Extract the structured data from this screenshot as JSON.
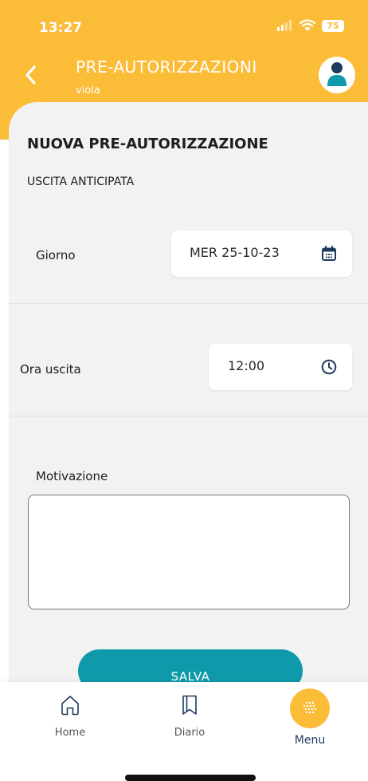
{
  "status_bar": {
    "time": "13:27",
    "battery": "75"
  },
  "header": {
    "title": "PRE-AUTORIZZAZIONI",
    "subtitle": "viola"
  },
  "form": {
    "title": "NUOVA PRE-AUTORIZZAZIONE",
    "type": "USCITA ANTICIPATA",
    "day_label": "Giorno",
    "day_value": "MER 25-10-23",
    "time_label": "Ora uscita",
    "time_value": "12:00",
    "reason_label": "Motivazione",
    "reason_value": "",
    "save_label": "SALVA"
  },
  "nav": {
    "home_label": "Home",
    "diario_label": "Diario",
    "menu_label": "Menu",
    "active": "menu"
  },
  "colors": {
    "accent": "#fbbc38",
    "primary_button": "#0f9aab",
    "text_dark": "#1d1d1d",
    "nav_active": "#1e3a5f"
  },
  "icons": {
    "back": "chevron-left-icon",
    "avatar": "person-icon",
    "calendar": "calendar-icon",
    "clock": "clock-icon",
    "home": "home-icon",
    "diario": "bookmark-icon",
    "menu": "dots-grid-icon"
  }
}
